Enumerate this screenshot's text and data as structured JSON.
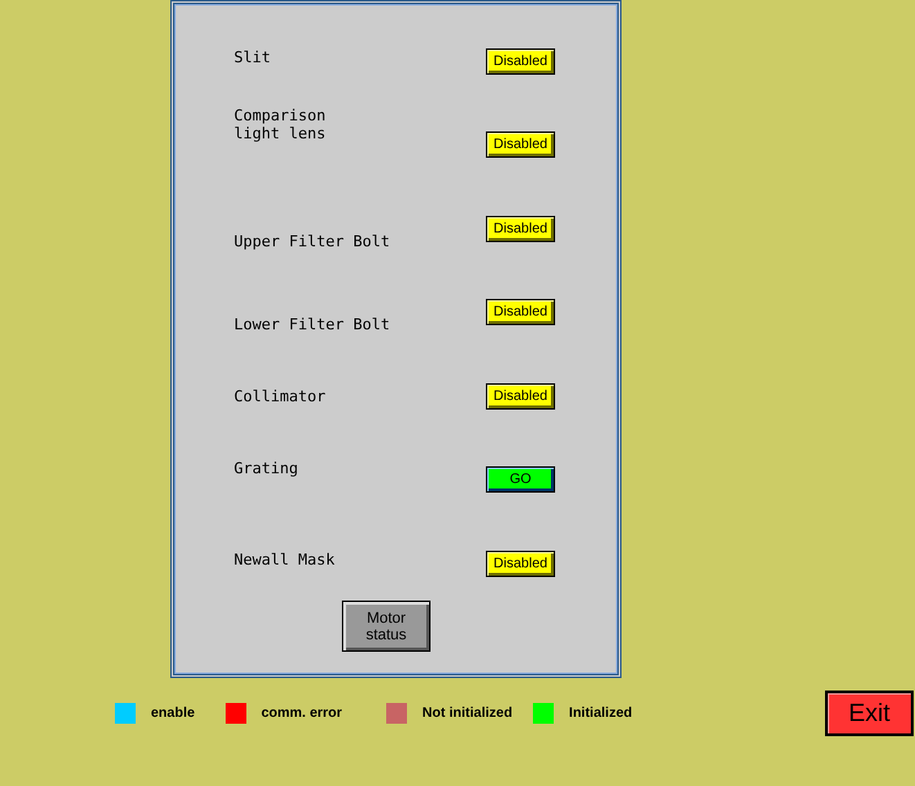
{
  "motors": [
    {
      "label": "Slit",
      "button": "Disabled",
      "kind": "disabled"
    },
    {
      "label": "Comparison\nlight lens",
      "button": "Disabled",
      "kind": "disabled"
    },
    {
      "label": "Upper Filter Bolt",
      "button": "Disabled",
      "kind": "disabled"
    },
    {
      "label": "Lower Filter Bolt",
      "button": "Disabled",
      "kind": "disabled"
    },
    {
      "label": "Collimator",
      "button": "Disabled",
      "kind": "disabled"
    },
    {
      "label": "Grating",
      "button": "GO",
      "kind": "go"
    },
    {
      "label": "Newall Mask",
      "button": "Disabled",
      "kind": "disabled"
    }
  ],
  "motor_status_button": "Motor\nstatus",
  "legend": [
    {
      "label": "enable",
      "color": "#00ccff"
    },
    {
      "label": "comm. error",
      "color": "#ff0000"
    },
    {
      "label": "Not initialized",
      "color": "#c86464"
    },
    {
      "label": "Initialized",
      "color": "#00ff00"
    }
  ],
  "exit_button": "Exit"
}
